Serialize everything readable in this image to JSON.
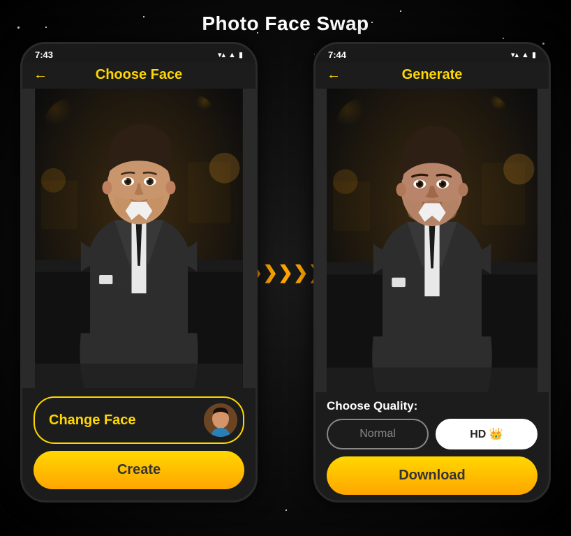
{
  "page": {
    "title": "Photo Face Swap",
    "background_color": "#0a0a0a"
  },
  "left_phone": {
    "status_time": "7:43",
    "header_title": "Choose Face",
    "back_arrow": "←",
    "change_face_label": "Change Face",
    "create_label": "Create"
  },
  "right_phone": {
    "status_time": "7:44",
    "header_title": "Generate",
    "back_arrow": "←",
    "quality_label": "Choose Quality:",
    "normal_label": "Normal",
    "hd_label": "HD 👑",
    "download_label": "Download"
  },
  "arrows": [
    "❯",
    "❯",
    "❯",
    "❯",
    "❯"
  ],
  "icons": {
    "back": "←",
    "signal": "▲",
    "wifi": "▲",
    "battery": "▮"
  }
}
